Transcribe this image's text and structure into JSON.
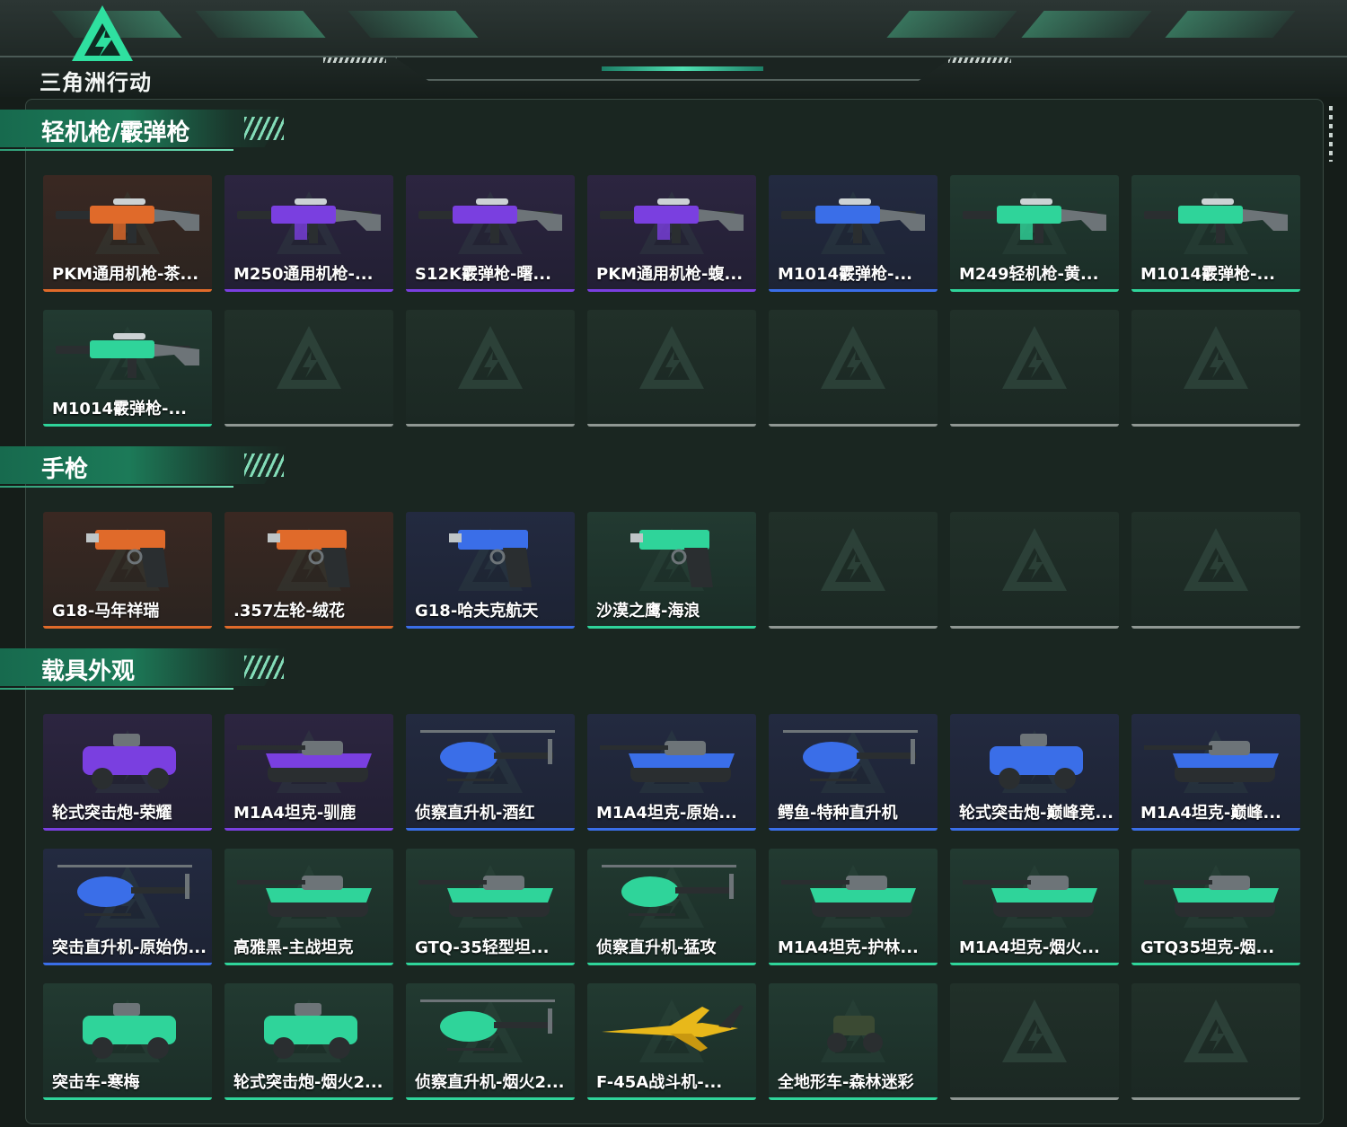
{
  "header": {
    "logo_text": "三角洲行动"
  },
  "colors": {
    "orange": "#e06a2a",
    "purple": "#7a3fe0",
    "blue": "#3a6ee8",
    "green": "#2fd49a",
    "empty": "#8f9793"
  },
  "sections": [
    {
      "title": "轻机枪/霰弹枪"
    },
    {
      "title": "手枪"
    },
    {
      "title": "载具外观"
    }
  ],
  "lmg": [
    {
      "label": "PKM通用机枪-茶...",
      "rarity": "orange",
      "icon": "machine-gun-icon"
    },
    {
      "label": "M250通用机枪-...",
      "rarity": "purple",
      "icon": "machine-gun-icon"
    },
    {
      "label": "S12K霰弹枪-曙...",
      "rarity": "purple",
      "icon": "shotgun-icon"
    },
    {
      "label": "PKM通用机枪-蝮...",
      "rarity": "purple",
      "icon": "machine-gun-icon"
    },
    {
      "label": "M1014霰弹枪-...",
      "rarity": "blue",
      "icon": "shotgun-icon"
    },
    {
      "label": "M249轻机枪-黄...",
      "rarity": "green",
      "icon": "machine-gun-icon"
    },
    {
      "label": "M1014霰弹枪-...",
      "rarity": "green",
      "icon": "shotgun-icon"
    },
    {
      "label": "M1014霰弹枪-...",
      "rarity": "green",
      "icon": "shotgun-icon"
    }
  ],
  "pistols": [
    {
      "label": "G18-马年祥瑞",
      "rarity": "orange",
      "icon": "pistol-icon"
    },
    {
      "label": ".357左轮-绒花",
      "rarity": "orange",
      "icon": "revolver-icon"
    },
    {
      "label": "G18-哈夫克航天",
      "rarity": "blue",
      "icon": "pistol-icon"
    },
    {
      "label": "沙漠之鹰-海浪",
      "rarity": "green",
      "icon": "pistol-icon"
    }
  ],
  "vehicles": [
    {
      "label": "轮式突击炮-荣耀",
      "rarity": "purple",
      "icon": "armored-car-icon"
    },
    {
      "label": "M1A4坦克-驯鹿",
      "rarity": "purple",
      "icon": "tank-icon"
    },
    {
      "label": "侦察直升机-酒红",
      "rarity": "blue",
      "icon": "helicopter-icon"
    },
    {
      "label": "M1A4坦克-原始...",
      "rarity": "blue",
      "icon": "tank-icon"
    },
    {
      "label": "鳄鱼-特种直升机",
      "rarity": "blue",
      "icon": "helicopter-icon"
    },
    {
      "label": "轮式突击炮-巅峰竞...",
      "rarity": "blue",
      "icon": "armored-car-icon"
    },
    {
      "label": "M1A4坦克-巅峰...",
      "rarity": "blue",
      "icon": "tank-icon"
    },
    {
      "label": "突击直升机-原始伪...",
      "rarity": "blue",
      "icon": "helicopter-icon"
    },
    {
      "label": "高雅黑-主战坦克",
      "rarity": "green",
      "icon": "tank-icon"
    },
    {
      "label": "GTQ-35轻型坦...",
      "rarity": "green",
      "icon": "tank-icon"
    },
    {
      "label": "侦察直升机-猛攻",
      "rarity": "green",
      "icon": "helicopter-icon"
    },
    {
      "label": "M1A4坦克-护林...",
      "rarity": "green",
      "icon": "tank-icon"
    },
    {
      "label": "M1A4坦克-烟火...",
      "rarity": "green",
      "icon": "tank-icon"
    },
    {
      "label": "GTQ35坦克-烟...",
      "rarity": "green",
      "icon": "tank-icon"
    },
    {
      "label": "突击车-寒梅",
      "rarity": "green",
      "icon": "armored-car-icon"
    },
    {
      "label": "轮式突击炮-烟火2...",
      "rarity": "green",
      "icon": "armored-car-icon"
    },
    {
      "label": "侦察直升机-烟火2...",
      "rarity": "green",
      "icon": "helicopter-icon"
    },
    {
      "label": "F-45A战斗机-...",
      "rarity": "green",
      "icon": "jet-icon"
    },
    {
      "label": "全地形车-森林迷彩",
      "rarity": "green",
      "icon": "atv-icon"
    }
  ]
}
